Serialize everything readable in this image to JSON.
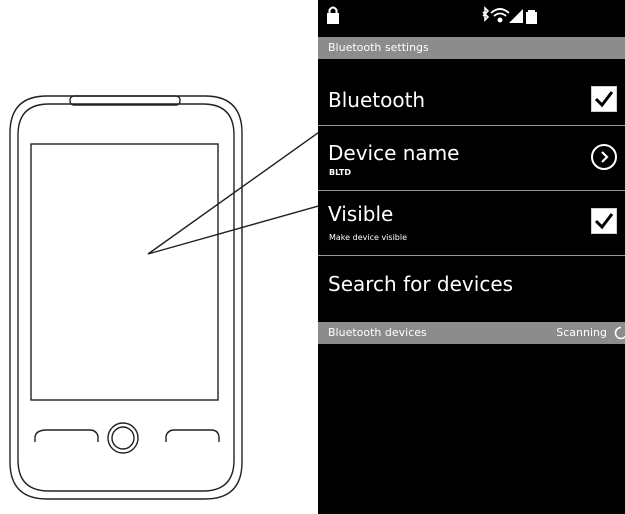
{
  "header": {
    "title": "Bluetooth settings"
  },
  "settings": [
    {
      "title": "Bluetooth",
      "control": "checkbox",
      "checked": true
    },
    {
      "title": "Device name",
      "subtitle": "BLTD",
      "control": "chevron"
    },
    {
      "title": "Visible",
      "subtitle": "Make device visible",
      "control": "checkbox",
      "checked": true
    },
    {
      "title": "Search for devices"
    }
  ],
  "devices_section": {
    "title": "Bluetooth devices",
    "status": "Scanning"
  },
  "status_icons": [
    "lock-icon",
    "bluetooth-icon",
    "wifi-icon",
    "signal-icon",
    "battery-icon"
  ],
  "colors": {
    "screen_bg": "#000000",
    "header_bg": "#8c8c8c",
    "text": "#ffffff",
    "divider": "#9a9a9a"
  }
}
